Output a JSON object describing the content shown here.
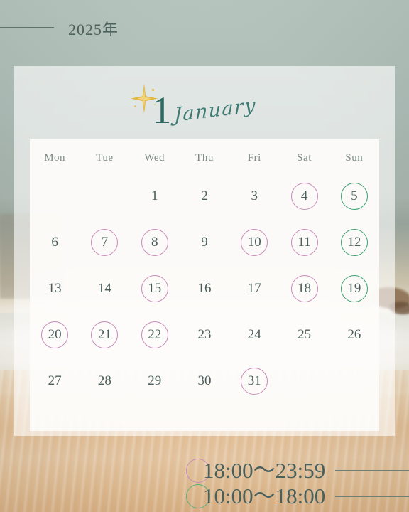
{
  "header": {
    "year_label": "2025年",
    "rule": "horizontal-rule"
  },
  "title": {
    "month_number": "1",
    "month_name": "January",
    "sparkle": "sparkle-star-icon",
    "sparkle_color": "#d9b23c",
    "number_color": "#2f6b63"
  },
  "calendar": {
    "weekdays": [
      "Mon",
      "Tue",
      "Wed",
      "Thu",
      "Fri",
      "Sat",
      "Sun"
    ],
    "weeks": [
      [
        {
          "day": "",
          "mark": "none"
        },
        {
          "day": "",
          "mark": "none"
        },
        {
          "day": "1",
          "mark": "none"
        },
        {
          "day": "2",
          "mark": "none"
        },
        {
          "day": "3",
          "mark": "none"
        },
        {
          "day": "4",
          "mark": "evening"
        },
        {
          "day": "5",
          "mark": "daytime"
        }
      ],
      [
        {
          "day": "6",
          "mark": "none"
        },
        {
          "day": "7",
          "mark": "evening"
        },
        {
          "day": "8",
          "mark": "evening"
        },
        {
          "day": "9",
          "mark": "none"
        },
        {
          "day": "10",
          "mark": "evening"
        },
        {
          "day": "11",
          "mark": "evening"
        },
        {
          "day": "12",
          "mark": "daytime"
        }
      ],
      [
        {
          "day": "13",
          "mark": "none"
        },
        {
          "day": "14",
          "mark": "none"
        },
        {
          "day": "15",
          "mark": "evening"
        },
        {
          "day": "16",
          "mark": "none"
        },
        {
          "day": "17",
          "mark": "none"
        },
        {
          "day": "18",
          "mark": "evening"
        },
        {
          "day": "19",
          "mark": "daytime"
        }
      ],
      [
        {
          "day": "20",
          "mark": "evening"
        },
        {
          "day": "21",
          "mark": "evening"
        },
        {
          "day": "22",
          "mark": "evening"
        },
        {
          "day": "23",
          "mark": "none"
        },
        {
          "day": "24",
          "mark": "none"
        },
        {
          "day": "25",
          "mark": "none"
        },
        {
          "day": "26",
          "mark": "none"
        }
      ],
      [
        {
          "day": "27",
          "mark": "none"
        },
        {
          "day": "28",
          "mark": "none"
        },
        {
          "day": "29",
          "mark": "none"
        },
        {
          "day": "30",
          "mark": "none"
        },
        {
          "day": "31",
          "mark": "evening"
        },
        {
          "day": "",
          "mark": "none"
        },
        {
          "day": "",
          "mark": "none"
        }
      ]
    ]
  },
  "legend": {
    "evening": {
      "time": "18:00～23:59",
      "circle_color": "#c98bb8"
    },
    "daytime": {
      "time": "10:00～18:00",
      "circle_color": "#5cb07f"
    }
  },
  "colors": {
    "background_sky": "#b5c3bd",
    "sand": "#e3bf96",
    "day_text": "#4a5f5c",
    "weekday_text": "#7b8a86",
    "card_background": "rgba(255,255,255,0.62)"
  }
}
